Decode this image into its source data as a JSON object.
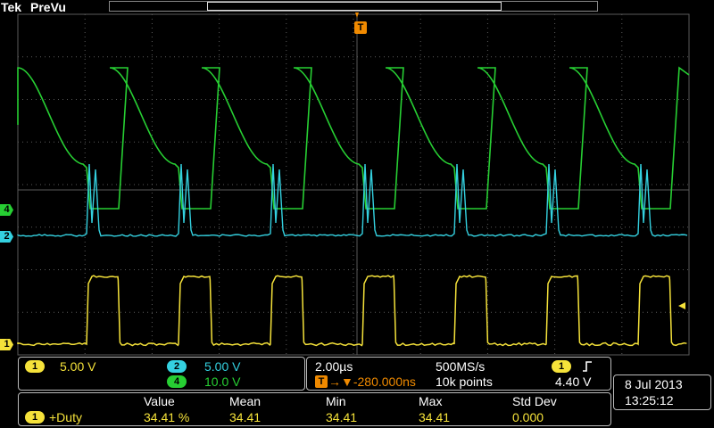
{
  "header": {
    "brand": "Tek",
    "mode": "PreVu",
    "trigger_marker": "T"
  },
  "channels": [
    {
      "id": "1",
      "color": "#f5e23a"
    },
    {
      "id": "2",
      "color": "#34d1e0"
    },
    {
      "id": "4",
      "color": "#27cf33"
    }
  ],
  "vertical_panel": {
    "ch1": {
      "label": "1",
      "scale": "5.00 V"
    },
    "ch2": {
      "label": "2",
      "scale": "5.00 V"
    },
    "ch4": {
      "label": "4",
      "scale": "10.0 V"
    }
  },
  "timebase_panel": {
    "time_div": "2.00µs",
    "sample_rate": "500MS/s",
    "trigger_icon": "T",
    "trigger_delay": "→▼-280.000ns",
    "record_length": "10k points",
    "trigger_source": "1",
    "trigger_slope_icon": "rising-edge-icon",
    "trigger_level": "4.40 V"
  },
  "datetime": {
    "date": "8 Jul 2013",
    "time": "13:25:12"
  },
  "measurements": {
    "headers": [
      "Value",
      "Mean",
      "Min",
      "Max",
      "Std Dev"
    ],
    "rows": [
      {
        "source": "1",
        "name": "+Duty",
        "value": "34.41 %",
        "mean": "34.41",
        "min": "34.41",
        "max": "34.41",
        "std_dev": "0.000"
      }
    ]
  },
  "colors": {
    "grid": "#5a5a5a",
    "trigger": "#f08a00",
    "panel_border": "#bbbbbb"
  }
}
